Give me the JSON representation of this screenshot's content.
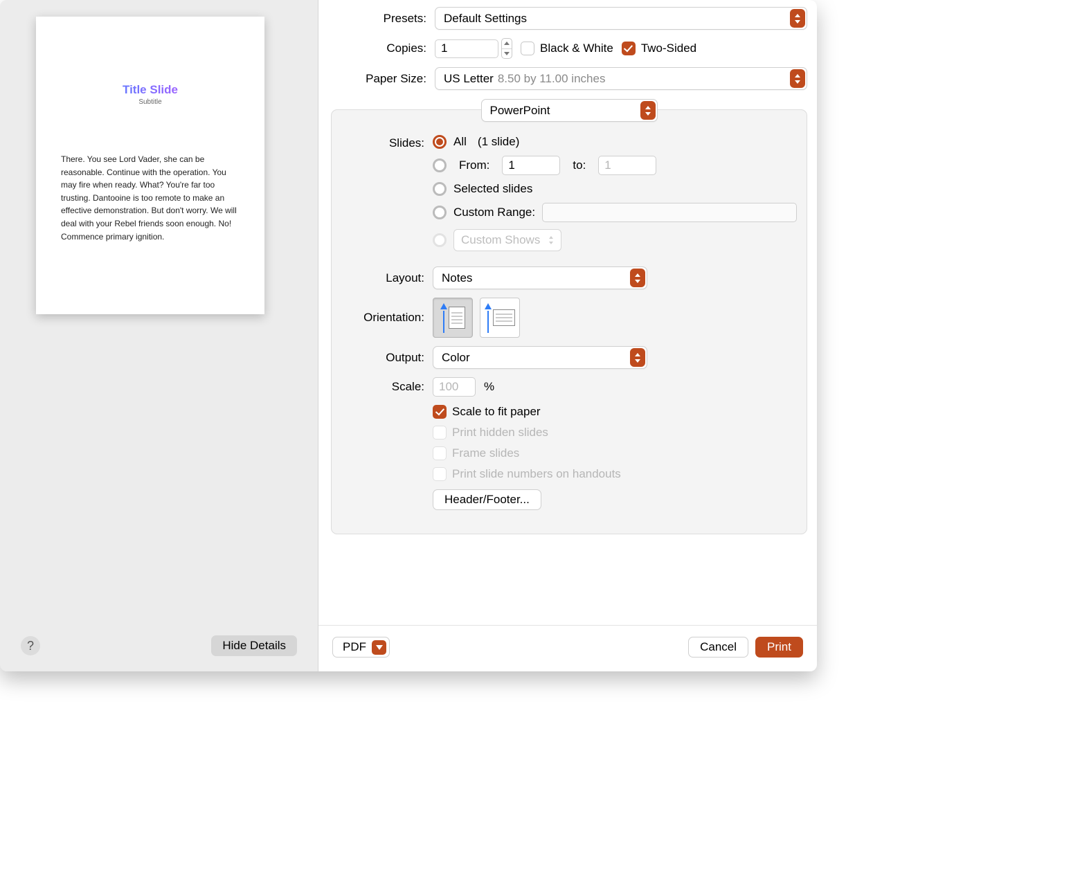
{
  "preview": {
    "title": "Title Slide",
    "subtitle": "Subtitle",
    "body": "There. You see Lord Vader, she can be reasonable. Continue with the operation. You may fire when ready. What? You're far too trusting. Dantooine is too remote to make an effective demonstration. But don't worry. We will deal with your Rebel friends soon enough. No! Commence primary ignition."
  },
  "labels": {
    "presets": "Presets:",
    "copies": "Copies:",
    "black_white": "Black & White",
    "two_sided": "Two-Sided",
    "paper_size": "Paper Size:",
    "slides": "Slides:",
    "layout": "Layout:",
    "orientation": "Orientation:",
    "output": "Output:",
    "scale": "Scale:",
    "percent": "%",
    "from": "From:",
    "to": "to:"
  },
  "presets_value": "Default Settings",
  "copies_value": "1",
  "black_white_checked": false,
  "two_sided_checked": true,
  "paper_size": {
    "name": "US Letter",
    "dims": "8.50 by 11.00 inches"
  },
  "section_select": "PowerPoint",
  "slides": {
    "all_label": "All",
    "all_count": "(1 slide)",
    "from_value": "1",
    "to_value": "1",
    "selected_label": "Selected slides",
    "custom_range_label": "Custom Range:",
    "custom_shows_label": "Custom Shows"
  },
  "layout_value": "Notes",
  "output_value": "Color",
  "scale_value": "100",
  "options": {
    "scale_fit": "Scale to fit paper",
    "print_hidden": "Print hidden slides",
    "frame": "Frame slides",
    "print_numbers": "Print slide numbers on handouts"
  },
  "header_footer_btn": "Header/Footer...",
  "footer": {
    "help": "?",
    "hide_details": "Hide Details",
    "pdf": "PDF",
    "cancel": "Cancel",
    "print": "Print"
  },
  "colors": {
    "accent": "#bf4b1d"
  }
}
